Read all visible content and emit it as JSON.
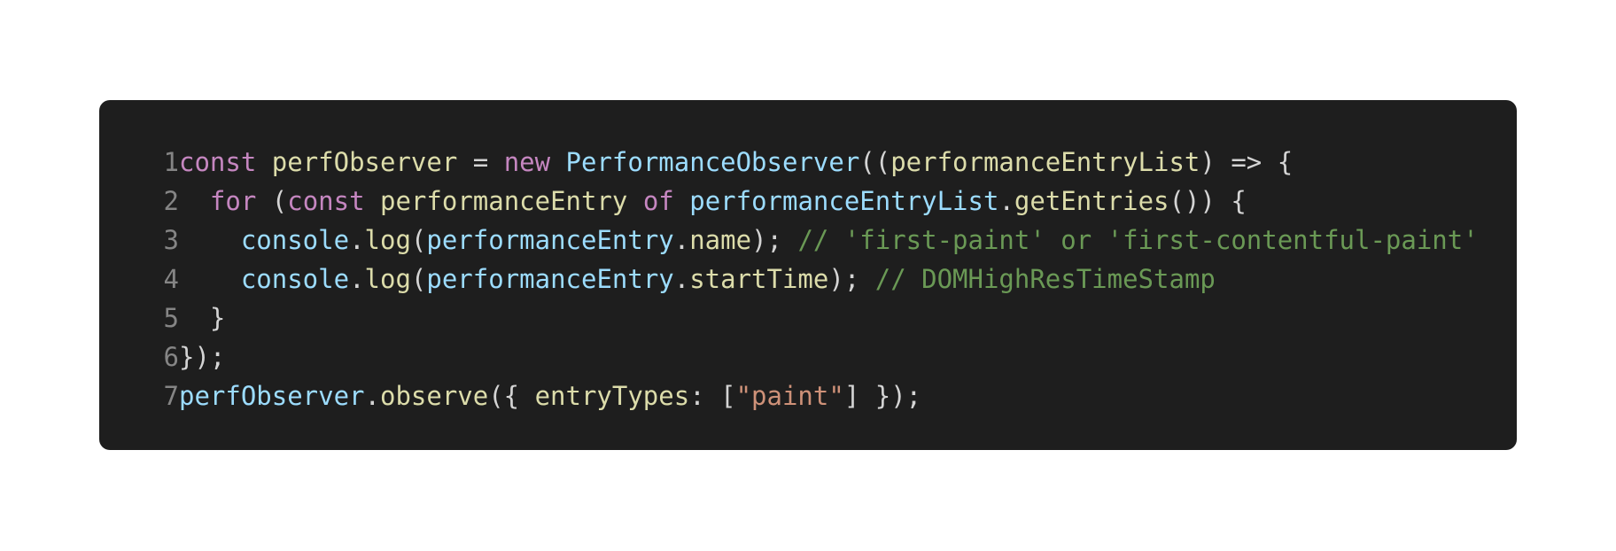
{
  "colors": {
    "page_background": "#ffffff",
    "editor_background": "#1e1e1e",
    "line_number": "#858585",
    "keyword": "#c586c0",
    "identifier": "#dcdcaa",
    "type": "#9cdcfe",
    "plain": "#d4d4d4",
    "comment": "#6a9955",
    "string": "#ce9178"
  },
  "code": {
    "language": "javascript",
    "lines": [
      {
        "number": "1",
        "tokens": [
          {
            "text": "const",
            "kind": "keyword"
          },
          {
            "text": " ",
            "kind": "plain"
          },
          {
            "text": "perfObserver",
            "kind": "ident"
          },
          {
            "text": " = ",
            "kind": "plain"
          },
          {
            "text": "new",
            "kind": "keyword"
          },
          {
            "text": " ",
            "kind": "plain"
          },
          {
            "text": "PerformanceObserver",
            "kind": "type"
          },
          {
            "text": "((",
            "kind": "plain"
          },
          {
            "text": "performanceEntryList",
            "kind": "ident"
          },
          {
            "text": ") => {",
            "kind": "plain"
          }
        ]
      },
      {
        "number": "2",
        "tokens": [
          {
            "text": "  ",
            "kind": "plain"
          },
          {
            "text": "for",
            "kind": "keyword"
          },
          {
            "text": " (",
            "kind": "plain"
          },
          {
            "text": "const",
            "kind": "keyword"
          },
          {
            "text": " ",
            "kind": "plain"
          },
          {
            "text": "performanceEntry",
            "kind": "ident"
          },
          {
            "text": " ",
            "kind": "plain"
          },
          {
            "text": "of",
            "kind": "keyword"
          },
          {
            "text": " ",
            "kind": "plain"
          },
          {
            "text": "performanceEntryList",
            "kind": "type"
          },
          {
            "text": ".",
            "kind": "plain"
          },
          {
            "text": "getEntries",
            "kind": "ident"
          },
          {
            "text": "()) {",
            "kind": "plain"
          }
        ]
      },
      {
        "number": "3",
        "tokens": [
          {
            "text": "    ",
            "kind": "plain"
          },
          {
            "text": "console",
            "kind": "type"
          },
          {
            "text": ".",
            "kind": "plain"
          },
          {
            "text": "log",
            "kind": "ident"
          },
          {
            "text": "(",
            "kind": "plain"
          },
          {
            "text": "performanceEntry",
            "kind": "type"
          },
          {
            "text": ".",
            "kind": "plain"
          },
          {
            "text": "name",
            "kind": "ident"
          },
          {
            "text": "); ",
            "kind": "plain"
          },
          {
            "text": "// 'first-paint' or 'first-contentful-paint'",
            "kind": "comment"
          }
        ]
      },
      {
        "number": "4",
        "tokens": [
          {
            "text": "    ",
            "kind": "plain"
          },
          {
            "text": "console",
            "kind": "type"
          },
          {
            "text": ".",
            "kind": "plain"
          },
          {
            "text": "log",
            "kind": "ident"
          },
          {
            "text": "(",
            "kind": "plain"
          },
          {
            "text": "performanceEntry",
            "kind": "type"
          },
          {
            "text": ".",
            "kind": "plain"
          },
          {
            "text": "startTime",
            "kind": "ident"
          },
          {
            "text": "); ",
            "kind": "plain"
          },
          {
            "text": "// DOMHighResTimeStamp",
            "kind": "comment"
          }
        ]
      },
      {
        "number": "5",
        "tokens": [
          {
            "text": "  }",
            "kind": "plain"
          }
        ]
      },
      {
        "number": "6",
        "tokens": [
          {
            "text": "});",
            "kind": "plain"
          }
        ]
      },
      {
        "number": "7",
        "tokens": [
          {
            "text": "perfObserver",
            "kind": "type"
          },
          {
            "text": ".",
            "kind": "plain"
          },
          {
            "text": "observe",
            "kind": "ident"
          },
          {
            "text": "({ ",
            "kind": "plain"
          },
          {
            "text": "entryTypes",
            "kind": "ident"
          },
          {
            "text": ": [",
            "kind": "plain"
          },
          {
            "text": "\"paint\"",
            "kind": "string"
          },
          {
            "text": "] });",
            "kind": "plain"
          }
        ]
      }
    ]
  }
}
